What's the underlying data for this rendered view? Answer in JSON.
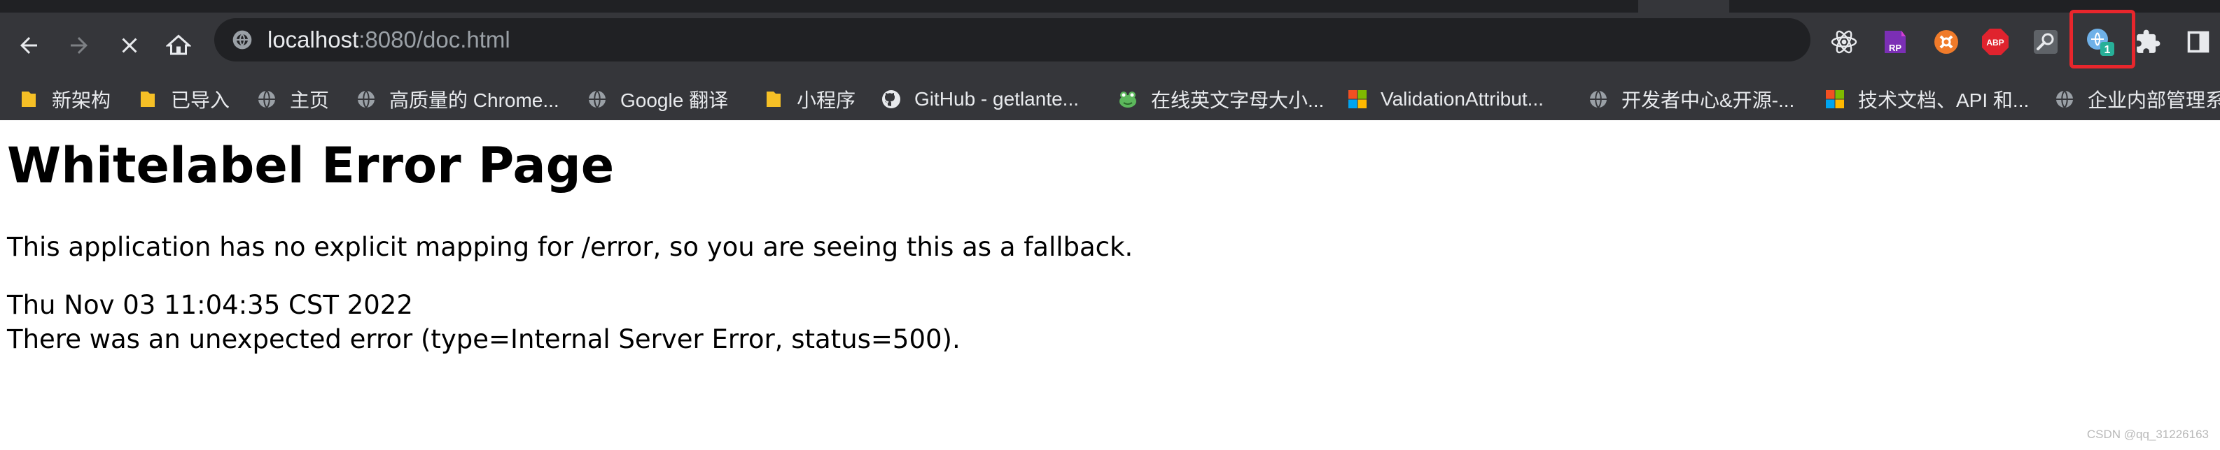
{
  "browser": {
    "address_bar": {
      "host": "localhost",
      "rest": ":8080/doc.html"
    },
    "extension_badge_count": "1",
    "extension_abp_label": "ABP",
    "extension_rp_label": "RP",
    "highlight_color": "#e8262c",
    "bookmarks": [
      {
        "label": "新架构",
        "icon": "folder-icon"
      },
      {
        "label": "已导入",
        "icon": "folder-icon"
      },
      {
        "label": "主页",
        "icon": "globe-icon"
      },
      {
        "label": "高质量的 Chrome...",
        "icon": "globe-icon"
      },
      {
        "label": "Google 翻译",
        "icon": "globe-icon"
      },
      {
        "label": "小程序",
        "icon": "folder-icon"
      },
      {
        "label": "GitHub - getlante...",
        "icon": "github-icon"
      },
      {
        "label": "在线英文字母大小...",
        "icon": "frog-icon"
      },
      {
        "label": "ValidationAttribut...",
        "icon": "microsoft-icon"
      },
      {
        "label": "开发者中心&开源-...",
        "icon": "globe-icon"
      },
      {
        "label": "技术文档、API 和...",
        "icon": "microsoft-icon"
      },
      {
        "label": "企业内部管理系",
        "icon": "globe-icon"
      }
    ]
  },
  "page": {
    "title": "Whitelabel Error Page",
    "message": "This application has no explicit mapping for /error, so you are seeing this as a fallback.",
    "timestamp": "Thu Nov 03 11:04:35 CST 2022",
    "error_detail": "There was an unexpected error (type=Internal Server Error, status=500)."
  },
  "watermark": "CSDN @qq_31226163"
}
